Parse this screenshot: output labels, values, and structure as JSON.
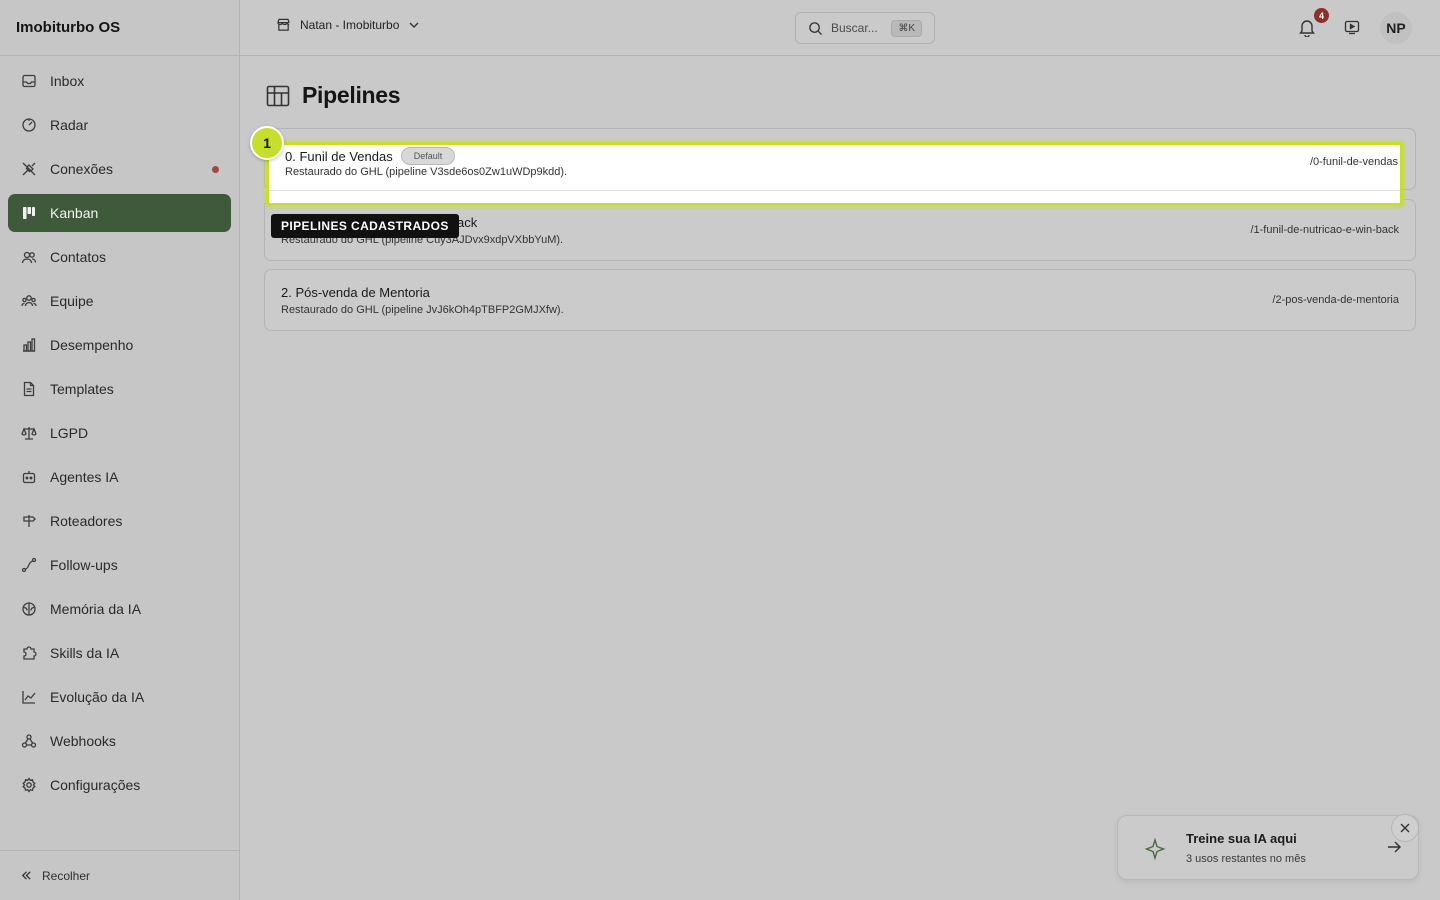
{
  "app": {
    "brand": "Imobiturbo OS"
  },
  "sidebar": {
    "items": [
      {
        "label": "Inbox",
        "icon": "inbox-icon"
      },
      {
        "label": "Radar",
        "icon": "radar-icon"
      },
      {
        "label": "Conexões",
        "icon": "plug-icon",
        "dot_color": "#9b4a46"
      },
      {
        "label": "Kanban",
        "icon": "kanban-icon",
        "active": true
      },
      {
        "label": "Contatos",
        "icon": "contacts-icon"
      },
      {
        "label": "Equipe",
        "icon": "team-icon"
      },
      {
        "label": "Desempenho",
        "icon": "bar-chart-icon"
      },
      {
        "label": "Templates",
        "icon": "document-icon"
      },
      {
        "label": "LGPD",
        "icon": "scale-icon"
      },
      {
        "label": "Agentes IA",
        "icon": "bot-icon"
      },
      {
        "label": "Roteadores",
        "icon": "signpost-icon"
      },
      {
        "label": "Follow-ups",
        "icon": "route-icon"
      },
      {
        "label": "Memória da IA",
        "icon": "brain-icon"
      },
      {
        "label": "Skills da IA",
        "icon": "puzzle-icon"
      },
      {
        "label": "Evolução da IA",
        "icon": "line-chart-icon"
      },
      {
        "label": "Webhooks",
        "icon": "webhook-icon"
      },
      {
        "label": "Configurações",
        "icon": "gear-icon"
      }
    ],
    "collapse_label": "Recolher"
  },
  "topbar": {
    "workspace": "Natan - Imobiturbo",
    "search_placeholder": "Buscar...",
    "search_shortcut": "⌘K",
    "notifications_count": "4",
    "avatar_initials": "NP"
  },
  "page": {
    "title": "Pipelines",
    "pipelines": [
      {
        "name": "0. Funil de Vendas",
        "badge": "Default",
        "description": "Restaurado do GHL (pipeline V3sde6os0Zw1uWDp9kdd).",
        "slug": "/0-funil-de-vendas"
      },
      {
        "name": "1. Funil de Nutricao e Win-back",
        "visible_name": "ack",
        "description": "Restaurado do GHL (pipeline Cuy3AJDvx9xdpVXbbYuM).",
        "slug": "/1-funil-de-nutricao-e-win-back"
      },
      {
        "name": "2. Pós-venda de Mentoria",
        "description": "Restaurado do GHL (pipeline JvJ6kOh4pTBFP2GMJXfw).",
        "slug": "/2-pos-venda-de-mentoria"
      }
    ]
  },
  "tour": {
    "step": "1",
    "label": "PIPELINES CADASTRADOS",
    "accent_color": "#c7de2f"
  },
  "train_widget": {
    "title": "Treine sua IA aqui",
    "subtitle": "3 usos restantes no mês"
  }
}
